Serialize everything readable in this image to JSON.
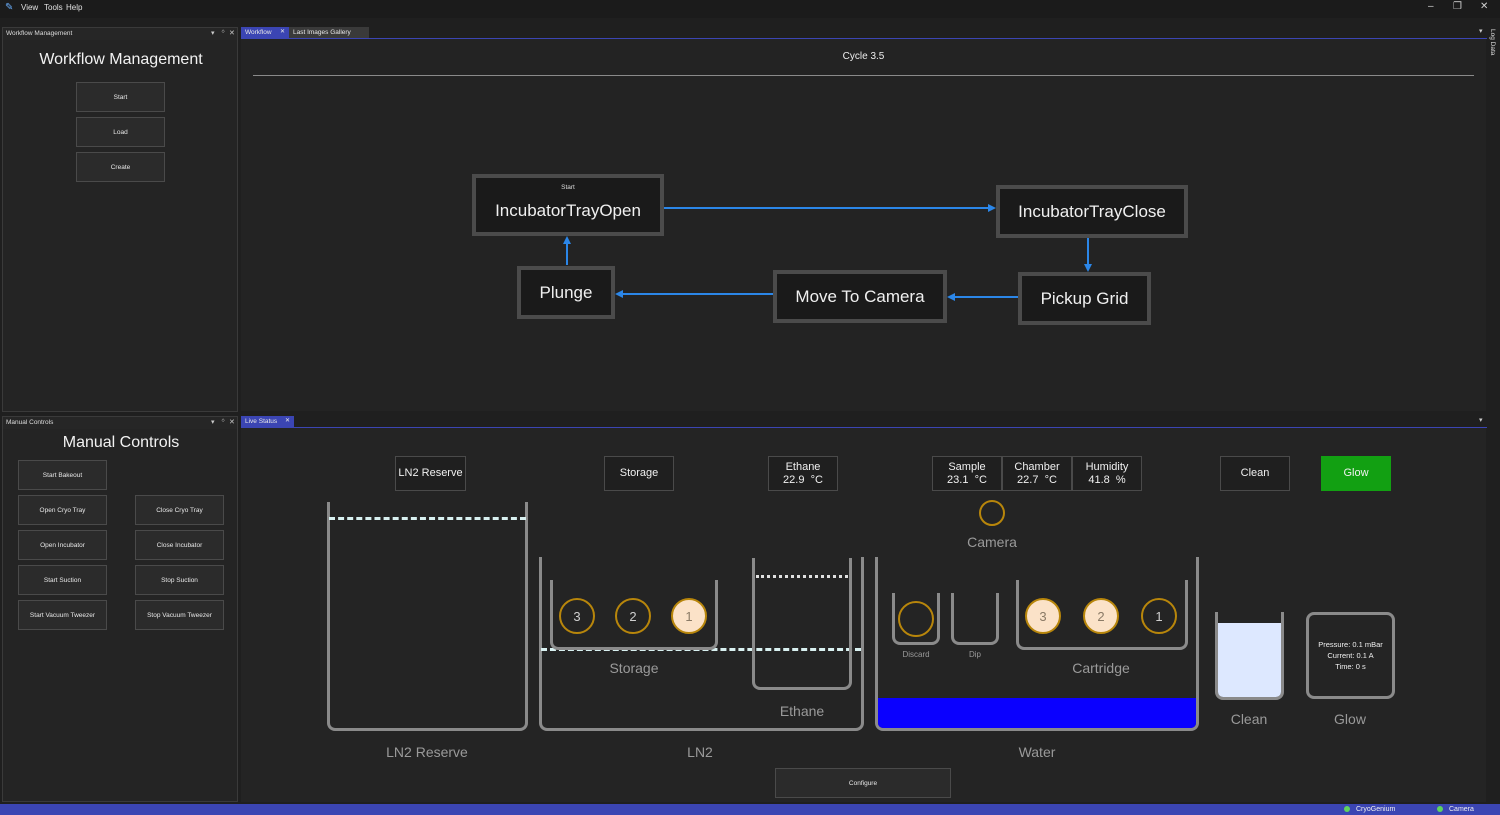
{
  "menubar": {
    "items": [
      "View",
      "Tools",
      "Help"
    ]
  },
  "window_controls": {
    "minimize": "–",
    "restore": "❐",
    "close": "✕"
  },
  "workflow_panel": {
    "header": "Workflow Management",
    "title": "Workflow Management",
    "buttons": [
      "Start",
      "Load",
      "Create"
    ]
  },
  "manual_panel": {
    "header": "Manual Controls",
    "title": "Manual Controls",
    "start_bakeout": "Start Bakeout",
    "open_cryo_tray": "Open Cryo Tray",
    "close_cryo_tray": "Close Cryo Tray",
    "open_incubator": "Open Incubator",
    "close_incubator": "Close Incubator",
    "start_suction": "Start Suction",
    "stop_suction": "Stop Suction",
    "start_vacuum_tweezer": "Start Vacuum Tweezer",
    "stop_vacuum_tweezer": "Stop Vacuum Tweezer"
  },
  "panel_ctl": {
    "dropdown": "▾",
    "pin": "ᛜ",
    "close": "✕"
  },
  "tabs": {
    "workflow": "Workflow",
    "gallery": "Last Images Gallery",
    "live_status": "Live Status",
    "close": "✕"
  },
  "side_tab": "Log Data",
  "workflow": {
    "cycle": "Cycle 3.5",
    "start_marker": "Start",
    "nodes": {
      "incubator_open": "IncubatorTrayOpen",
      "incubator_close": "IncubatorTrayClose",
      "pickup_grid": "Pickup Grid",
      "move_to_camera": "Move To Camera",
      "plunge": "Plunge"
    }
  },
  "live_status": {
    "ln2_reserve_box": "LN2 Reserve",
    "storage_box": "Storage",
    "ethane": {
      "label": "Ethane",
      "value": "22.9",
      "unit": "°C"
    },
    "sample": {
      "label": "Sample",
      "value": "23.1",
      "unit": "°C"
    },
    "chamber": {
      "label": "Chamber",
      "value": "22.7",
      "unit": "°C"
    },
    "humidity": {
      "label": "Humidity",
      "value": "41.8",
      "unit": "%"
    },
    "clean_box": "Clean",
    "glow_box": "Glow",
    "camera_label": "Camera",
    "vessel_labels": {
      "ln2_reserve": "LN2 Reserve",
      "ln2": "LN2",
      "storage": "Storage",
      "ethane": "Ethane",
      "water": "Water",
      "discard": "Discard",
      "dip": "Dip",
      "cartridge": "Cartridge",
      "clean": "Clean",
      "glow": "Glow"
    },
    "storage_slots": [
      "3",
      "2",
      "1"
    ],
    "cartridge_slots": [
      "3",
      "2",
      "1"
    ],
    "glow_info": {
      "pressure": "Pressure: 0.1 mBar",
      "current": "Current: 0.1 A",
      "time": "Time: 0 s"
    },
    "configure_button": "Configure"
  },
  "statusbar": {
    "cryogenium": "CryoGenium",
    "camera": "Camera"
  },
  "colors": {
    "accent": "#3b45b3",
    "arrow": "#2b86e8",
    "glow_active": "#12a012",
    "water": "#0a00ff",
    "slot_ring": "#b8860b",
    "slot_filled": "#fbe2c8"
  }
}
